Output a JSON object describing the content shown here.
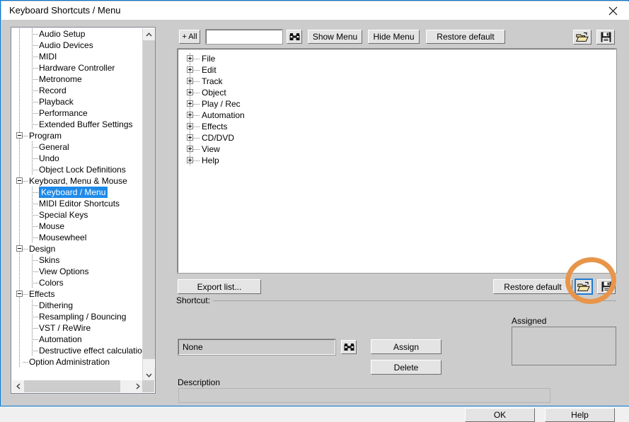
{
  "window": {
    "title": "Keyboard Shortcuts / Menu",
    "close_icon": "close-icon",
    "accent_color": "#0078d7",
    "selection_color": "#1e8ae8",
    "annotation_color": "#e8954a"
  },
  "sidebar": {
    "items": [
      {
        "label": "Audio Setup",
        "depth": 2,
        "expander": "none",
        "selected": false
      },
      {
        "label": "Audio Devices",
        "depth": 2,
        "expander": "none",
        "selected": false
      },
      {
        "label": "MIDI",
        "depth": 2,
        "expander": "none",
        "selected": false
      },
      {
        "label": "Hardware Controller",
        "depth": 2,
        "expander": "none",
        "selected": false
      },
      {
        "label": "Metronome",
        "depth": 2,
        "expander": "none",
        "selected": false
      },
      {
        "label": "Record",
        "depth": 2,
        "expander": "none",
        "selected": false
      },
      {
        "label": "Playback",
        "depth": 2,
        "expander": "none",
        "selected": false
      },
      {
        "label": "Performance",
        "depth": 2,
        "expander": "none",
        "selected": false
      },
      {
        "label": "Extended Buffer Settings",
        "depth": 2,
        "expander": "none",
        "selected": false
      },
      {
        "label": "Program",
        "depth": 1,
        "expander": "minus",
        "selected": false
      },
      {
        "label": "General",
        "depth": 2,
        "expander": "none",
        "selected": false
      },
      {
        "label": "Undo",
        "depth": 2,
        "expander": "none",
        "selected": false
      },
      {
        "label": "Object Lock Definitions",
        "depth": 2,
        "expander": "none",
        "selected": false
      },
      {
        "label": "Keyboard, Menu & Mouse",
        "depth": 1,
        "expander": "minus",
        "selected": false
      },
      {
        "label": "Keyboard / Menu",
        "depth": 2,
        "expander": "none",
        "selected": true
      },
      {
        "label": "MIDI Editor Shortcuts",
        "depth": 2,
        "expander": "none",
        "selected": false
      },
      {
        "label": "Special Keys",
        "depth": 2,
        "expander": "none",
        "selected": false
      },
      {
        "label": "Mouse",
        "depth": 2,
        "expander": "none",
        "selected": false
      },
      {
        "label": "Mousewheel",
        "depth": 2,
        "expander": "none",
        "selected": false
      },
      {
        "label": "Design",
        "depth": 1,
        "expander": "minus",
        "selected": false
      },
      {
        "label": "Skins",
        "depth": 2,
        "expander": "none",
        "selected": false
      },
      {
        "label": "View Options",
        "depth": 2,
        "expander": "none",
        "selected": false
      },
      {
        "label": "Colors",
        "depth": 2,
        "expander": "none",
        "selected": false
      },
      {
        "label": "Effects",
        "depth": 1,
        "expander": "minus",
        "selected": false
      },
      {
        "label": "Dithering",
        "depth": 2,
        "expander": "none",
        "selected": false
      },
      {
        "label": "Resampling / Bouncing",
        "depth": 2,
        "expander": "none",
        "selected": false
      },
      {
        "label": "VST / ReWire",
        "depth": 2,
        "expander": "none",
        "selected": false
      },
      {
        "label": "Automation",
        "depth": 2,
        "expander": "none",
        "selected": false
      },
      {
        "label": "Destructive effect calculation",
        "depth": 2,
        "expander": "none",
        "selected": false
      },
      {
        "label": "Option Administration",
        "depth": 1,
        "expander": "none",
        "selected": false
      }
    ],
    "scrollbar": {
      "up_arrow_icon": "chevron-up-icon",
      "down_arrow_icon": "chevron-down-icon",
      "left_arrow_icon": "chevron-left-icon",
      "right_arrow_icon": "chevron-right-icon"
    }
  },
  "toolbar": {
    "all_label": "+ All",
    "search_value": "",
    "search_placeholder": "",
    "find_icon": "binoculars-icon",
    "show_menu_label": "Show Menu",
    "hide_menu_label": "Hide Menu",
    "restore_default_label": "Restore default",
    "open_icon": "open-folder-icon",
    "save_icon": "floppy-disk-save-icon"
  },
  "menu_tree": {
    "items": [
      {
        "label": "File"
      },
      {
        "label": "Edit"
      },
      {
        "label": "Track"
      },
      {
        "label": "Object"
      },
      {
        "label": "Play / Rec"
      },
      {
        "label": "Automation"
      },
      {
        "label": "Effects"
      },
      {
        "label": "CD/DVD"
      },
      {
        "label": "View"
      },
      {
        "label": "Help"
      }
    ]
  },
  "actions": {
    "export_list_label": "Export list...",
    "restore_default_label": "Restore default",
    "open_icon": "open-folder-icon",
    "save_icon": "floppy-disk-save-icon"
  },
  "shortcut": {
    "group_label": "Shortcut:",
    "value": "None",
    "find_icon": "binoculars-icon",
    "assign_label": "Assign",
    "delete_label": "Delete",
    "description_label": "Description",
    "description_value": "",
    "assigned_label": "Assigned",
    "assigned_value": ""
  },
  "footer": {
    "ok_label": "OK",
    "help_label": "Help"
  }
}
